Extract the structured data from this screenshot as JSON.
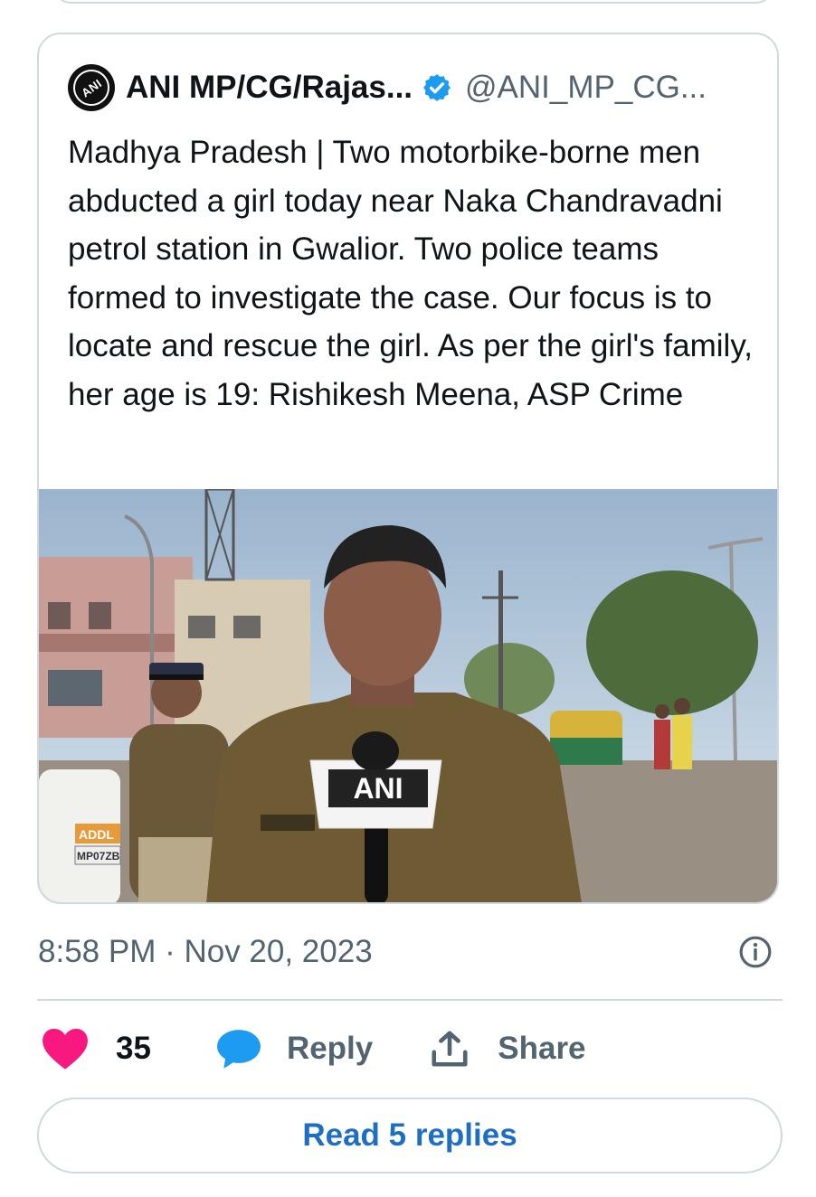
{
  "quoted_tweet": {
    "display_name": "ANI MP/CG/Rajas...",
    "handle": "@ANI_MP_CG...",
    "avatar_text": "ANI",
    "verified": true,
    "text": "Madhya Pradesh | Two motorbike-borne men abducted a girl today near Naka Chandravadni petrol station in Gwalior. Two police teams formed to investigate the case. Our focus is to locate and rescue the girl. As per the girl's family, her age is 19: Rishikesh Meena, ASP Crime",
    "media": {
      "mic_flag_text": "ANI",
      "number_plate_text": "MP07ZB",
      "plate_tag_text": "ADDL"
    }
  },
  "timestamp": "8:58 PM · Nov 20, 2023",
  "actions": {
    "likes_count": "35",
    "reply_label": "Reply",
    "share_label": "Share"
  },
  "read_replies_label": "Read 5 replies",
  "colors": {
    "heart": "#f91880",
    "reply_bubble": "#1d9bf0",
    "link_blue": "#1d6fc4",
    "verified": "#1d9bf0",
    "muted_text": "#536471",
    "border": "#cfd9de"
  },
  "icons": {
    "heart": "heart-icon",
    "reply": "speech-bubble-icon",
    "share": "share-upload-icon",
    "info": "info-circle-icon",
    "verified": "verified-badge-icon"
  }
}
